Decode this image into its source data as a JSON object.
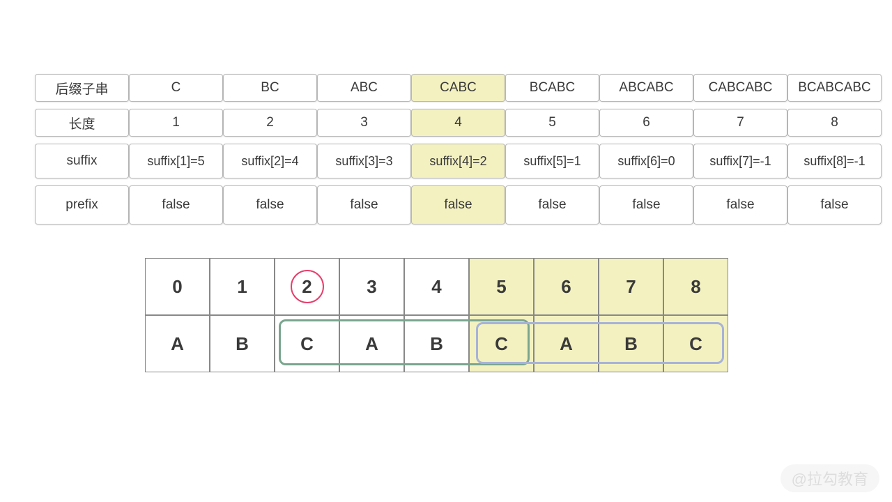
{
  "upper": {
    "rows": [
      {
        "label": "后缀子串",
        "cells": [
          "C",
          "BC",
          "ABC",
          "CABC",
          "BCABC",
          "ABCABC",
          "CABCABC",
          "BCABCABC"
        ]
      },
      {
        "label": "长度",
        "cells": [
          "1",
          "2",
          "3",
          "4",
          "5",
          "6",
          "7",
          "8"
        ]
      },
      {
        "label": "suffix",
        "cells": [
          "suffix[1]=5",
          "suffix[2]=4",
          "suffix[3]=3",
          "suffix[4]=2",
          "suffix[5]=1",
          "suffix[6]=0",
          "suffix[7]=-1",
          "suffix[8]=-1"
        ]
      },
      {
        "label": "prefix",
        "cells": [
          "false",
          "false",
          "false",
          "false",
          "false",
          "false",
          "false",
          "false"
        ]
      }
    ],
    "highlight_col": 4
  },
  "lower": {
    "row1": [
      "0",
      "1",
      "2",
      "3",
      "4",
      "5",
      "6",
      "7",
      "8"
    ],
    "row2": [
      "A",
      "B",
      "C",
      "A",
      "B",
      "C",
      "A",
      "B",
      "C"
    ],
    "hl_from_index": 5,
    "circled_index": 2
  },
  "watermark": "@拉勾教育"
}
